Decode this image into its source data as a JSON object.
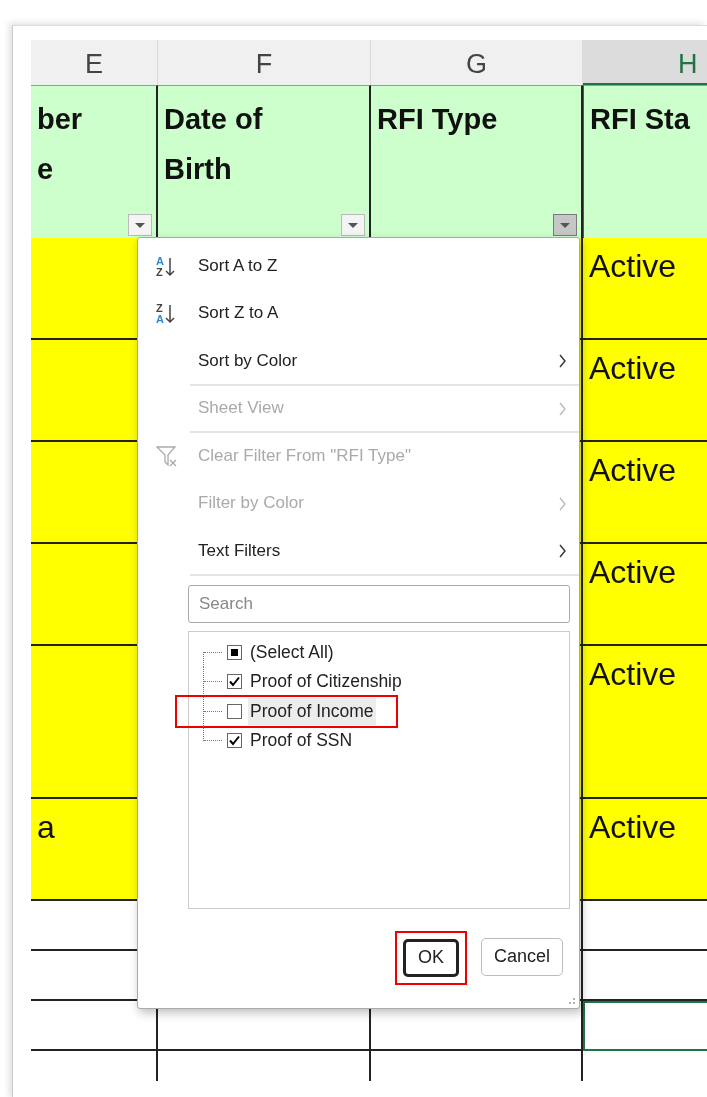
{
  "columns": [
    {
      "letter": "E",
      "selected": false
    },
    {
      "letter": "F",
      "selected": false
    },
    {
      "letter": "G",
      "selected": false
    },
    {
      "letter": "H",
      "selected": true
    }
  ],
  "header_cells": [
    {
      "lines": [
        "ber",
        "e"
      ],
      "filter_button": true,
      "filter_active": false
    },
    {
      "lines": [
        "Date of",
        "Birth"
      ],
      "filter_button": true,
      "filter_active": false
    },
    {
      "lines": [
        "RFI Type"
      ],
      "filter_button": true,
      "filter_active": true
    },
    {
      "lines": [
        "RFI Sta"
      ],
      "filter_button": false
    }
  ],
  "rows": [
    {
      "highlighted": true,
      "column_h": "Active"
    },
    {
      "highlighted": true,
      "column_h": "Active"
    },
    {
      "highlighted": true,
      "column_h": "Active"
    },
    {
      "highlighted": true,
      "column_h": "Active"
    },
    {
      "highlighted": true,
      "column_h": "Active"
    },
    {
      "highlighted": true,
      "column_e": "a",
      "column_h": "Active"
    },
    {
      "highlighted": false,
      "selected": false
    },
    {
      "highlighted": false,
      "selected": false
    },
    {
      "highlighted": false,
      "selected": true
    },
    {
      "highlighted": false,
      "selected": false
    }
  ],
  "filter_menu": {
    "items": [
      {
        "label": "Sort A to Z",
        "kind": "sort",
        "icon_letters": [
          "A",
          "Z"
        ],
        "submenu": false,
        "disabled": false,
        "divider_after": false
      },
      {
        "label": "Sort Z to A",
        "kind": "sort",
        "icon_letters": [
          "Z",
          "A"
        ],
        "submenu": false,
        "disabled": false,
        "divider_after": false
      },
      {
        "label": "Sort by Color",
        "kind": "plain",
        "submenu": true,
        "disabled": false,
        "divider_after": true
      },
      {
        "label": "Sheet View",
        "kind": "plain",
        "submenu": true,
        "disabled": true,
        "divider_after": true
      },
      {
        "label": "Clear Filter From \"RFI Type\"",
        "kind": "clear",
        "submenu": false,
        "disabled": true,
        "divider_after": false
      },
      {
        "label": "Filter by Color",
        "kind": "plain",
        "submenu": true,
        "disabled": true,
        "divider_after": false
      },
      {
        "label": "Text Filters",
        "kind": "plain",
        "submenu": true,
        "disabled": false,
        "divider_after": true
      }
    ],
    "search": {
      "placeholder": "Search"
    },
    "values": [
      {
        "label": "(Select All)",
        "checked": true,
        "mixed": true,
        "highlighted": false,
        "hovered": false
      },
      {
        "label": "Proof of Citizenship",
        "checked": true,
        "mixed": false,
        "highlighted": false,
        "hovered": false
      },
      {
        "label": "Proof of Income",
        "checked": false,
        "mixed": false,
        "highlighted": true,
        "hovered": true
      },
      {
        "label": "Proof of SSN",
        "checked": true,
        "mixed": false,
        "highlighted": false,
        "hovered": false
      }
    ],
    "buttons": [
      {
        "label": "OK",
        "default": true,
        "highlighted": true
      },
      {
        "label": "Cancel",
        "default": false,
        "highlighted": false
      }
    ]
  }
}
